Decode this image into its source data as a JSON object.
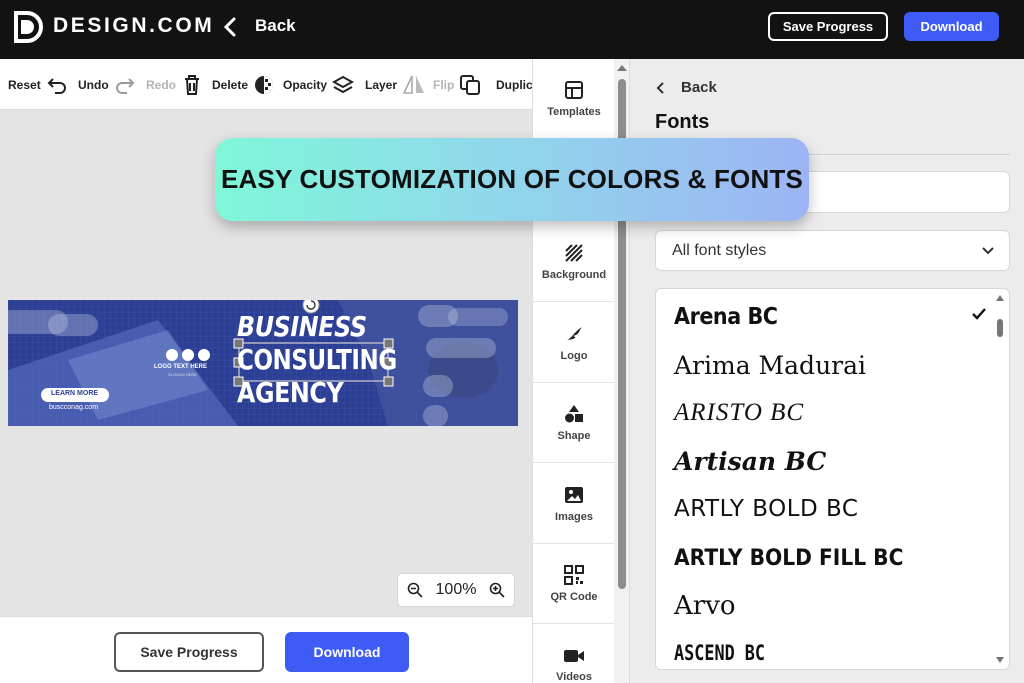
{
  "app": {
    "brand": "DESIGN.COM",
    "back_label": "Back",
    "save_progress_label": "Save Progress",
    "download_label": "Download"
  },
  "toolbar": {
    "items": [
      {
        "label": "Reset",
        "icon": "reset-icon",
        "disabled": false
      },
      {
        "label": "Undo",
        "icon": "undo-icon",
        "disabled": false
      },
      {
        "label": "Redo",
        "icon": "redo-icon",
        "disabled": true
      },
      {
        "label": "Delete",
        "icon": "trash-icon",
        "disabled": false
      },
      {
        "label": "Opacity",
        "icon": "opacity-icon",
        "disabled": false
      },
      {
        "label": "Layer",
        "icon": "layers-icon",
        "disabled": false
      },
      {
        "label": "Flip",
        "icon": "flip-icon",
        "disabled": true
      },
      {
        "label": "Duplic",
        "icon": "duplicate-icon",
        "disabled": false
      }
    ]
  },
  "canvas": {
    "zoom": "100%",
    "banner": {
      "headline_1": "BUSINESS",
      "headline_2": "CONSULTING",
      "headline_3": "AGENCY",
      "logo_text": "LOGO TEXT HERE",
      "tagline": "SLOGAN HERE",
      "cta": "LEARN MORE",
      "url": "buscconag.com"
    }
  },
  "bottom": {
    "save_progress_label": "Save Progress",
    "download_label": "Download"
  },
  "sidenav": {
    "items": [
      {
        "label": "Templates",
        "icon": "templates-icon"
      },
      {
        "label": "Background",
        "icon": "background-icon"
      },
      {
        "label": "Logo",
        "icon": "logo-icon"
      },
      {
        "label": "Shape",
        "icon": "shape-icon"
      },
      {
        "label": "Images",
        "icon": "image-icon"
      },
      {
        "label": "QR Code",
        "icon": "qr-code-icon"
      },
      {
        "label": "Videos",
        "icon": "video-icon"
      }
    ]
  },
  "panel": {
    "back_label": "Back",
    "title": "Fonts",
    "search_placeholder": "",
    "style_filter": "All font styles",
    "fonts": [
      {
        "name": "Arena BC",
        "selected": true
      },
      {
        "name": "Arima Madurai",
        "selected": false
      },
      {
        "name": "ARISTO BC",
        "selected": false
      },
      {
        "name": "Artisan BC",
        "selected": false
      },
      {
        "name": "ARTLY BOLD BC",
        "selected": false
      },
      {
        "name": "ARTLY BOLD FILL BC",
        "selected": false
      },
      {
        "name": "Arvo",
        "selected": false
      },
      {
        "name": "ASCEND BC",
        "selected": false
      }
    ]
  },
  "overlay": {
    "caption": "EASY CUSTOMIZATION OF COLORS & FONTS"
  },
  "colors": {
    "topbar_bg": "#121212",
    "accent_blue": "#3f5bf5",
    "banner_blue": "#2a3d8f",
    "overlay_gradient_start": "#7ff7d9",
    "overlay_gradient_end": "#9db4f4"
  }
}
